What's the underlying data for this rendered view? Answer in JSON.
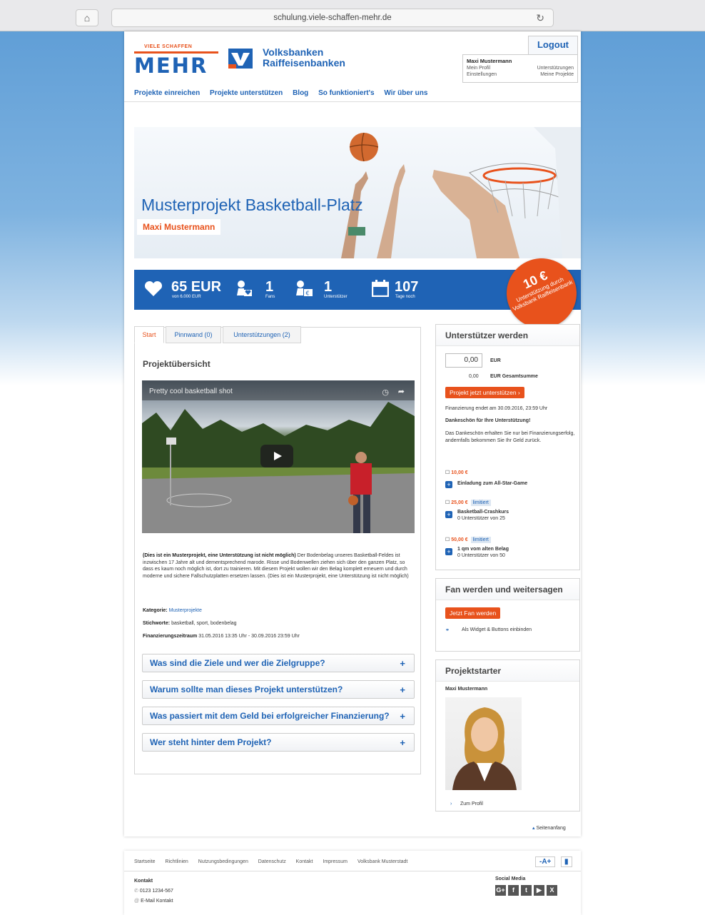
{
  "browser": {
    "url": "schulung.viele-schaffen-mehr.de"
  },
  "header": {
    "logo_small": "VIELE SCHAFFEN",
    "logo_big": "MEHR",
    "bank_line1": "Volksbanken",
    "bank_line2": "Raiffeisenbanken",
    "logout": "Logout",
    "user": {
      "name": "Maxi Mustermann",
      "links_left": [
        "Mein Profil",
        "Einstellungen"
      ],
      "links_right": [
        "Unterstützungen",
        "Meine Projekte"
      ]
    }
  },
  "nav": [
    "Projekte einreichen",
    "Projekte unterstützen",
    "Blog",
    "So funktioniert's",
    "Wir über uns"
  ],
  "hero": {
    "title": "Musterprojekt Basketball-Platz",
    "starter": "Maxi Mustermann"
  },
  "stats": [
    {
      "value": "65 EUR",
      "label": "von 6.000 EUR",
      "icon": "heart-icon"
    },
    {
      "value": "1",
      "label": "Fans",
      "icon": "fan-icon"
    },
    {
      "value": "1",
      "label": "Unterstützer",
      "icon": "supporter-icon"
    },
    {
      "value": "107",
      "label": "Tage noch",
      "icon": "calendar-icon"
    }
  ],
  "badge": {
    "big": "10 €",
    "text": "Unterstützung durch Volksbank Raiffeisenbank"
  },
  "tabs": [
    "Start",
    "Pinnwand (0)",
    "Unterstützungen (2)"
  ],
  "main": {
    "section_title": "Projektübersicht",
    "video_title": "Pretty cool basketball shot",
    "desc_bold": "(Dies ist ein Musterprojekt, eine Unterstützung ist nicht möglich)",
    "desc_text": " Der Bodenbelag unseres Basketball-Feldes ist inzwischen 17 Jahre alt und dementsprechend marode. Risse und Bodenwellen ziehen sich über den ganzen Platz, so dass es kaum noch möglich ist, dort zu trainieren. Mit diesem Projekt wollen wir den Belag komplett erneuern und durch moderne und sichere Fallschutzplatten ersetzen lassen. (Dies ist ein Musterprojekt, eine Unterstützung ist nicht möglich)",
    "kategorie_label": "Kategorie:",
    "kategorie_value": "Musterprojekte",
    "stichworte_label": "Stichworte:",
    "stichworte_value": "basketball, sport, bodenbelag",
    "zeitraum_label": "Finanzierungszeitraum",
    "zeitraum_value": "31.05.2016 13:35 Uhr - 30.09.2016 23:59 Uhr",
    "accordion": [
      "Was sind die Ziele und wer die Zielgruppe?",
      "Warum sollte man dieses Projekt unterstützen?",
      "Was passiert mit dem Geld bei erfolgreicher Finanzierung?",
      "Wer steht hinter dem Projekt?"
    ]
  },
  "support": {
    "title": "Unterstützer werden",
    "amount": "0,00",
    "eur": "EUR",
    "total_value": "0,00",
    "total_label": "EUR Gesamtsumme",
    "button": "Projekt jetzt unterstützen ›",
    "ends": "Finanzierung endet am 30.09.2016, 23:59 Uhr",
    "thanks_title": "Dankeschön für Ihre Unterstützung!",
    "thanks_text": "Das Dankeschön erhalten Sie nur bei Finanzierungserfolg, andernfalls bekommen Sie Ihr Geld zurück.",
    "perks": [
      {
        "price": "10,00 €",
        "limit": "",
        "title": "Einladung zum All-Star-Game",
        "sub": ""
      },
      {
        "price": "25,00 €",
        "limit": "limitiert",
        "title": "Basketball-Crashkurs",
        "sub": "0 Unterstützer von 25"
      },
      {
        "price": "50,00 €",
        "limit": "limitiert",
        "title": "1 qm vom alten Belag",
        "sub": "0 Unterstützer von 50"
      }
    ]
  },
  "fan": {
    "title": "Fan werden und weitersagen",
    "button": "Jetzt Fan werden",
    "widget": "Als Widget & Buttons einbinden"
  },
  "starter": {
    "title": "Projektstarter",
    "name": "Maxi Mustermann",
    "profile_link": "Zum Profil"
  },
  "seitenanfang": "Seitenanfang",
  "footer": {
    "links": [
      "Startseite",
      "Richtlinien",
      "Nutzungsbedingungen",
      "Datenschutz",
      "Kontakt",
      "Impressum",
      "Volksbank Musterstadt"
    ],
    "font_larger": "-A+",
    "font_mode": "▮",
    "kontakt_title": "Kontakt",
    "phone": "0123 1234-567",
    "email": "E-Mail Kontakt",
    "social_title": "Social Media",
    "social": [
      "G+",
      "f",
      "t",
      "▶",
      "X"
    ]
  }
}
